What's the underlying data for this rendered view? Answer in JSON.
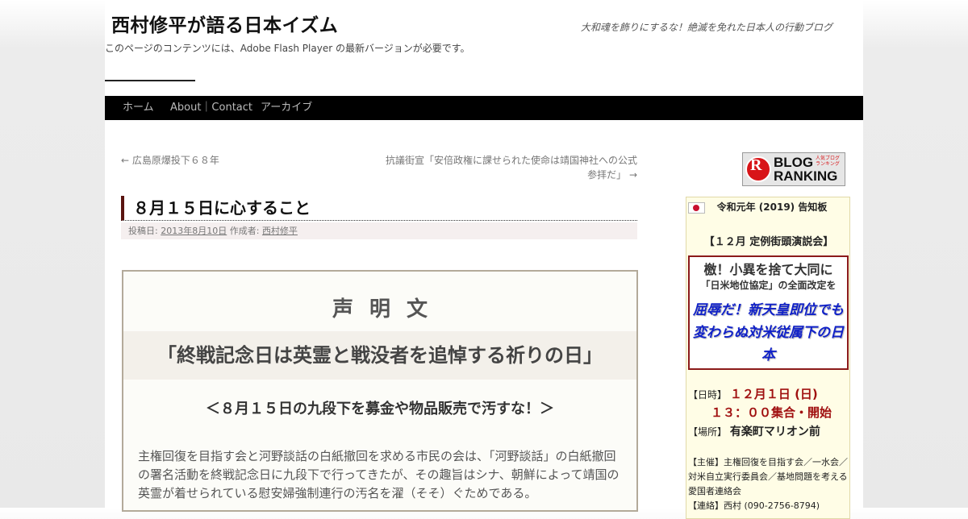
{
  "header": {
    "site_title": "西村修平が語る日本イズム",
    "site_description": "大和魂を飾りにするな！絶滅を免れた日本人の行動ブログ",
    "flash_note": "このページのコンテンツには、Adobe Flash Player の最新バージョンが必要です。"
  },
  "menu": {
    "items": [
      {
        "label": "ホーム"
      },
      {
        "label": "About｜Contact"
      },
      {
        "label": "アーカイブ"
      }
    ]
  },
  "post_nav": {
    "prev": "← 広島原爆投下６８年",
    "next": "抗議街宣「安倍政権に課せられた使命は靖国神社への公式参拝だ」 →"
  },
  "entry": {
    "title": "８月１５日に心すること",
    "meta_posted": "投稿日:",
    "meta_date": "2013年8月10日",
    "meta_author_label": "作成者:",
    "meta_author": "西村修平"
  },
  "statement": {
    "heading": "声明文",
    "title": "「終戦記念日は英霊と戦没者を追悼する祈りの日」",
    "subtitle": "＜８月１５日の九段下を募金や物品販売で汚すな！＞",
    "body": "主権回復を目指す会と河野談話の白紙撤回を求める市民の会は、「河野談話」の白紙撤回の署名活動を終戦記念日に九段下で行ってきたが、その趣旨はシナ、朝鮮によって靖国の英霊が着せられている慰安婦強制連行の汚名を濯（そそ）ぐためである。"
  },
  "sidebar": {
    "blog_ranking": {
      "circle": "R",
      "line1": "BLOG",
      "line2": "RANKING",
      "tiny": "人気ブログランキング"
    },
    "notice": {
      "date_line": "令和元年 (2019) 告知板",
      "event": "【１２月 定例街頭演説会】",
      "box_line1": "檄！小異を捨て大同に",
      "box_line2": "「日米地位協定」の全面改定を",
      "box_line3": "屈辱だ！新天皇即位でも変わらぬ対米従属下の日本",
      "date_label": "【日時】",
      "date_value": "１２月１日 (日)",
      "time_value": "１３：００集合・開始",
      "place_label": "【場所】",
      "place_value": "有楽町マリオン前",
      "organizer": "【主催】主権回復を目指す会／一水会／対米自立実行委員会／基地問題を考える愛国者連絡会",
      "contact": "【連絡】西村 (090-2756-8794)"
    }
  },
  "colors": {
    "nav_bar": "#000000",
    "title_accent": "#5a1410",
    "notice_box_border": "#8b1a1a",
    "notice_highlight": "#1021c8",
    "date_red": "#a01010"
  }
}
